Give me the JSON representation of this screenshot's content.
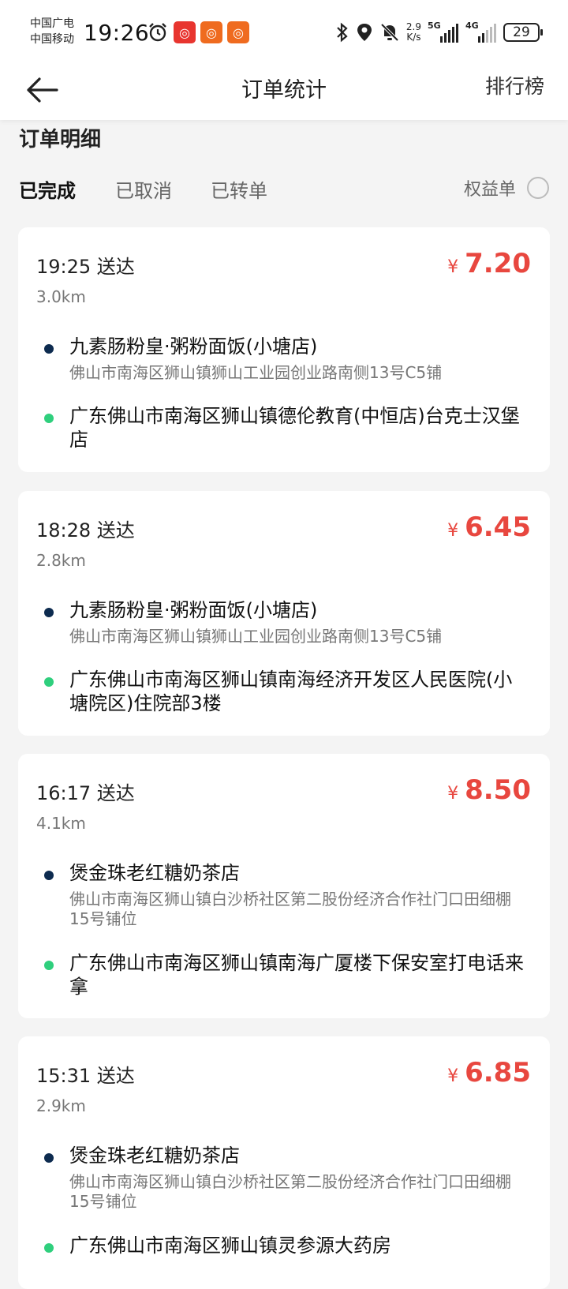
{
  "status_bar": {
    "carrier_1": "中国广电",
    "carrier_2": "中国移动",
    "time": "19:26",
    "speed_value": "2.9",
    "speed_unit": "K/s",
    "network_1": "5G",
    "network_2": "4G",
    "battery": "29",
    "colors": {
      "app_red": "#e8352f",
      "app_orange": "#ef6b1f"
    }
  },
  "navbar": {
    "title": "订单统计",
    "right_action": "排行榜"
  },
  "section": {
    "title": "订单明细"
  },
  "tabs": {
    "items": [
      "已完成",
      "已取消",
      "已转单"
    ],
    "active": "已完成",
    "rights_label": "权益单"
  },
  "orders": [
    {
      "time": "19:25 送达",
      "distance": "3.0km",
      "currency": "¥",
      "amount": "7.20",
      "pickup_name": "九素肠粉皇·粥粉面饭(小塘店)",
      "pickup_address": "佛山市南海区狮山镇狮山工业园创业路南侧13号C5铺",
      "dropoff_name": "广东佛山市南海区狮山镇德伦教育(中恒店)台克士汉堡店"
    },
    {
      "time": "18:28 送达",
      "distance": "2.8km",
      "currency": "¥",
      "amount": "6.45",
      "pickup_name": "九素肠粉皇·粥粉面饭(小塘店)",
      "pickup_address": "佛山市南海区狮山镇狮山工业园创业路南侧13号C5铺",
      "dropoff_name": "广东佛山市南海区狮山镇南海经济开发区人民医院(小塘院区)住院部3楼"
    },
    {
      "time": "16:17 送达",
      "distance": "4.1km",
      "currency": "¥",
      "amount": "8.50",
      "pickup_name": "煲金珠老红糖奶茶店",
      "pickup_address": "佛山市南海区狮山镇白沙桥社区第二股份经济合作社门口田细棚15号铺位",
      "dropoff_name": "广东佛山市南海区狮山镇南海广厦楼下保安室打电话来拿"
    },
    {
      "time": "15:31 送达",
      "distance": "2.9km",
      "currency": "¥",
      "amount": "6.85",
      "pickup_name": "煲金珠老红糖奶茶店",
      "pickup_address": "佛山市南海区狮山镇白沙桥社区第二股份经济合作社门口田细棚15号铺位",
      "dropoff_name": "广东佛山市南海区狮山镇灵参源大药房"
    }
  ],
  "colors": {
    "price": "#e8473f",
    "pickup_dot": "#0d2b4f",
    "dropoff_dot": "#2fcf7d",
    "background": "#f4f4f4"
  }
}
